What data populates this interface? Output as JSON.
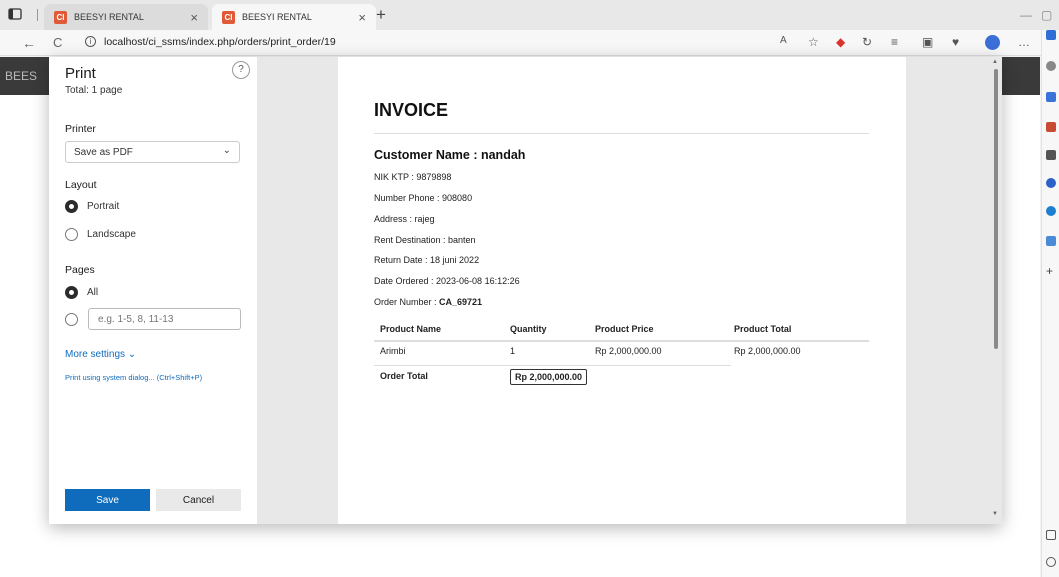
{
  "browser": {
    "tabs": [
      {
        "favicon": "CI",
        "title": "BEESYI RENTAL",
        "close": "×"
      },
      {
        "favicon": "CI",
        "title": "BEESYI RENTAL",
        "close": "×"
      }
    ],
    "new_tab": "+",
    "url": "localhost/ci_ssms/index.php/orders/print_order/19",
    "back": "←",
    "reload": "C",
    "info": "i"
  },
  "background_page": {
    "brand": "BEES"
  },
  "print_panel": {
    "title": "Print",
    "total": "Total: 1 page",
    "help": "?",
    "printer_label": "Printer",
    "printer_value": "Save as PDF",
    "layout_label": "Layout",
    "layout_options": [
      "Portrait",
      "Landscape"
    ],
    "layout_selected": "Portrait",
    "pages_label": "Pages",
    "pages_all": "All",
    "pages_placeholder": "e.g. 1-5, 8, 11-13",
    "more_settings": "More settings ⌄",
    "system_dialog": "Print using system dialog... (Ctrl+Shift+P)",
    "save": "Save",
    "cancel": "Cancel"
  },
  "invoice": {
    "title": "INVOICE",
    "customer": "Customer Name : nandah",
    "nik": "NIK KTP : 9879898",
    "phone": "Number Phone : 908080",
    "address": "Address : rajeg",
    "destination": "Rent Destination : banten",
    "return_date": "Return Date : 18 juni 2022",
    "date_ordered": "Date Ordered : 2023-06-08 16:12:26",
    "order_number_label": "Order Number : ",
    "order_number": "CA_69721",
    "table": {
      "headers": [
        "Product Name",
        "Quantity",
        "Product Price",
        "Product Total"
      ],
      "rows": [
        [
          "Arimbi",
          "1",
          "Rp 2,000,000.00",
          "Rp 2,000,000.00"
        ]
      ],
      "total_label": "Order Total",
      "total_value": "Rp 2,000,000.00"
    }
  }
}
